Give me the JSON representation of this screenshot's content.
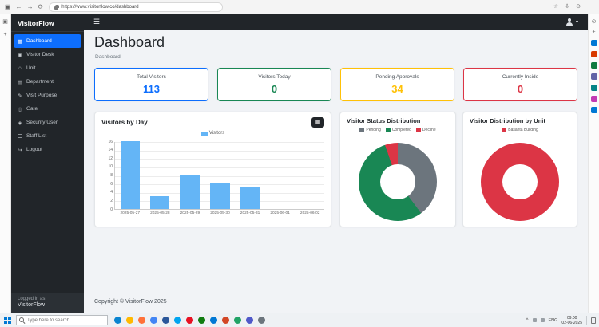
{
  "browser": {
    "url": "https://www.visitorflow.co/dashboard",
    "icons": {
      "tab": "▣",
      "back": "←",
      "forward": "→",
      "refresh": "⟳",
      "favorites": "☆",
      "downloads": "⇩",
      "profile": "⊙",
      "menu": "⋯",
      "plus": "+",
      "search": "⊙"
    }
  },
  "app_navbar": {
    "hamburger": "☰",
    "user_caret": "▾"
  },
  "sidebar": {
    "brand": "VisitorFlow",
    "items": [
      {
        "label": "Dashboard",
        "icon": "▦",
        "active": true
      },
      {
        "label": "Visitor Desk",
        "icon": "▣",
        "active": false
      },
      {
        "label": "Unit",
        "icon": "⌂",
        "active": false
      },
      {
        "label": "Department",
        "icon": "▤",
        "active": false
      },
      {
        "label": "Visit Purpose",
        "icon": "✎",
        "active": false
      },
      {
        "label": "Gate",
        "icon": "▯",
        "active": false
      },
      {
        "label": "Security User",
        "icon": "◈",
        "active": false
      },
      {
        "label": "Staff List",
        "icon": "☰",
        "active": false
      },
      {
        "label": "Logout",
        "icon": "↪",
        "active": false
      }
    ],
    "logged_in_label": "Logged in as:",
    "logged_in_user": "VisitorFlow"
  },
  "page": {
    "title": "Dashboard",
    "breadcrumb": "Dashboard",
    "footer": "Copyright © VisitorFlow 2025",
    "calendar_icon": "▦"
  },
  "stats": [
    {
      "label": "Total Visitors",
      "value": "113",
      "color": "#0d6efd"
    },
    {
      "label": "Visitors Today",
      "value": "0",
      "color": "#198754"
    },
    {
      "label": "Pending Approvals",
      "value": "34",
      "color": "#ffc107"
    },
    {
      "label": "Currently Inside",
      "value": "0",
      "color": "#dc3545"
    }
  ],
  "chart_data": [
    {
      "type": "bar",
      "title": "Visitors by Day",
      "legend": [
        "Visitors"
      ],
      "categories": [
        "2025-05-27",
        "2025-05-28",
        "2025-05-29",
        "2025-05-30",
        "2025-05-31",
        "2025-06-01",
        "2025-06-02"
      ],
      "values": [
        16,
        3,
        8,
        6,
        5,
        0,
        0
      ],
      "xlabel": "",
      "ylabel": "",
      "ylim": [
        0,
        16
      ],
      "yticks": [
        0,
        2,
        4,
        6,
        8,
        10,
        12,
        14,
        16
      ],
      "bar_color": "#64b5f6",
      "grid": true,
      "legend_position": "top"
    },
    {
      "type": "pie",
      "title": "Visitor Status Distribution",
      "labels": [
        "Pending",
        "Completed",
        "Decline"
      ],
      "values": [
        45,
        62,
        6
      ],
      "colors": [
        "#6c757d",
        "#198754",
        "#dc3545"
      ],
      "hole": 0.45,
      "legend_position": "top"
    },
    {
      "type": "pie",
      "title": "Visitor Distribution by Unit",
      "labels": [
        "Basanta Building"
      ],
      "values": [
        113
      ],
      "colors": [
        "#dc3545"
      ],
      "hole": 0.45,
      "legend_position": "top"
    }
  ],
  "taskbar": {
    "search_placeholder": "Type here to search",
    "tray": {
      "chevron": "^",
      "language": "ENG",
      "time": "09:00",
      "date": "02-06-2025"
    },
    "app_colors": [
      "#0a84d0",
      "#ffb900",
      "#ff7139",
      "#4285f4",
      "#2b579a",
      "#00a4ef",
      "#e81123",
      "#107c10",
      "#0078d4",
      "#d24726",
      "#21a366",
      "#5059c9",
      "#6c757d"
    ]
  },
  "edge_sidebar": {
    "app_colors": [
      "#0078d4",
      "#d83b01",
      "#107c41",
      "#6264a7",
      "#038387",
      "#c239b3",
      "#0078d4"
    ]
  }
}
